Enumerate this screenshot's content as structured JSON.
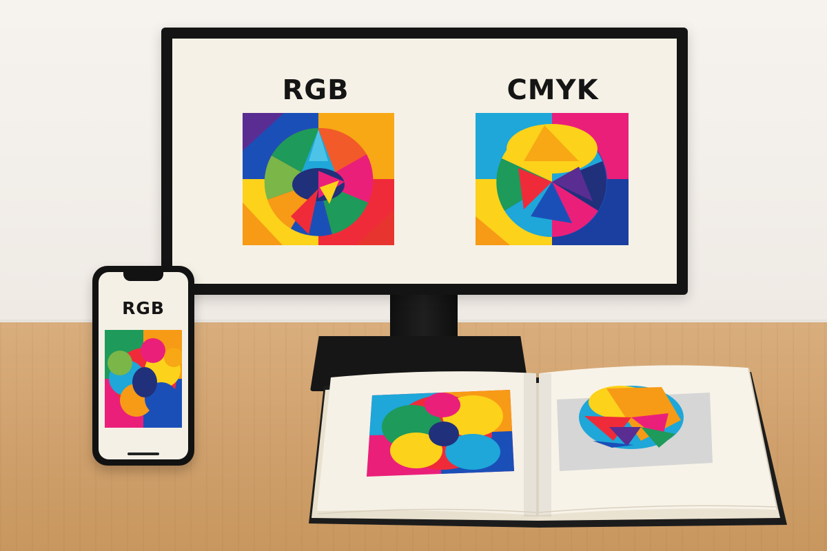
{
  "monitor": {
    "left_label": "RGB",
    "right_label": "CMYK"
  },
  "phone": {
    "label": "RGB"
  },
  "colors": {
    "wall": "#f3efe9",
    "desk": "#d4a571",
    "bezel": "#141414",
    "screen": "#f5f1e6",
    "red": "#ef2b3a",
    "magenta": "#ea1f7a",
    "yellow": "#fcd21a",
    "orange": "#f79a16",
    "blue": "#1b4fb8",
    "cyan": "#1ea7d8",
    "green": "#1e9a5a",
    "purple": "#5a2d92"
  },
  "icons": [
    "monitor-device",
    "smartphone-device",
    "open-book"
  ]
}
